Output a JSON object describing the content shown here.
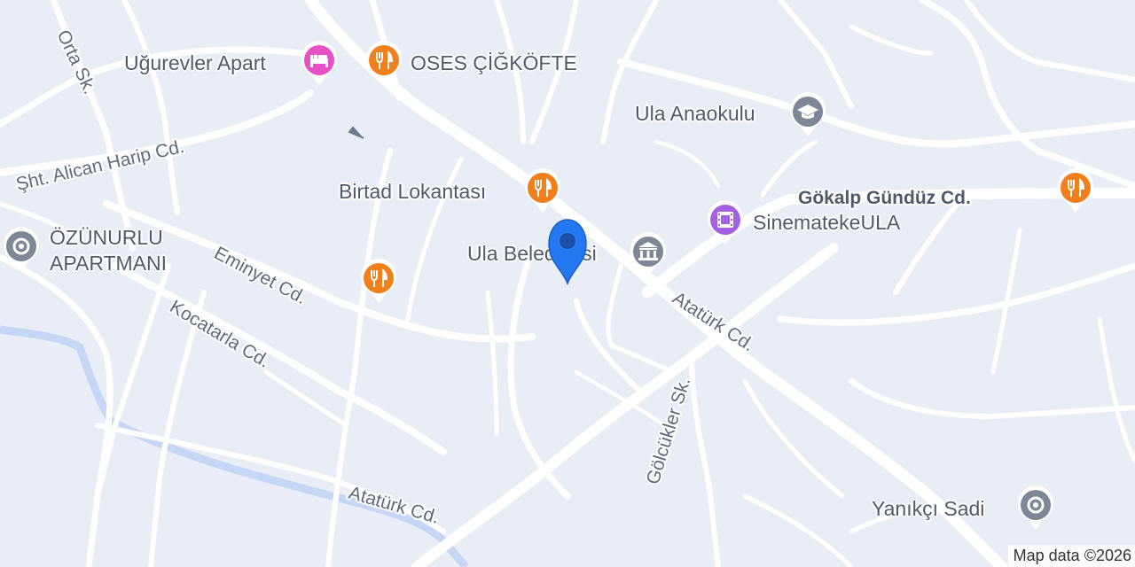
{
  "map": {
    "attribution": "Map data ©2026",
    "colors": {
      "background": "#e9edf6",
      "road": "#ffffff",
      "river": "#c5d7f5",
      "label": "#5f6b7d",
      "food_pin": "#f07f1c",
      "lodging_pin": "#e651c8",
      "education_pin": "#7d8896",
      "entertainment_pin": "#a45fe3",
      "civic_pin": "#7d8896",
      "place_pin": "#7d8896",
      "selected_marker": "#2479f2"
    }
  },
  "streets": {
    "orta": "Orta Sk.",
    "sht_alican": "Şht. Alican Harip Cd.",
    "eminyet": "Eminyet Cd.",
    "kocatarla": "Kocatarla Cd.",
    "ataturk_upper": "Atatürk Cd.",
    "ataturk_lower": "Atatürk Cd.",
    "golcukler": "Gölcükler Sk.",
    "gokalp": "Gökalp Gündüz Cd."
  },
  "places": {
    "ugurevler": {
      "name": "Uğurevler Apart",
      "icon": "bed-icon"
    },
    "oses": {
      "name": "OSES ÇİĞKÖFTE",
      "icon": "fork-knife-icon"
    },
    "ula_anaokulu": {
      "name": "Ula Anaokulu",
      "icon": "graduation-cap-icon"
    },
    "birtad": {
      "name": "Birtad Lokantası",
      "icon": "fork-knife-icon"
    },
    "sinemateke": {
      "name": "SinematekeULA",
      "icon": "film-icon"
    },
    "ula_belediyesi": {
      "name": "Ula Belediyesi",
      "icon": "town-hall-icon"
    },
    "ozunurlu_line1": "ÖZÜNURLU",
    "ozunurlu_line2": "APARTMANI",
    "ozunurlu_icon": "place-dot-icon",
    "yanikci": {
      "name": "Yanıkçı Sadi",
      "icon": "place-dot-icon"
    },
    "restaurant_unlabeled_1": {
      "icon": "fork-knife-icon"
    },
    "restaurant_unlabeled_2": {
      "icon": "fork-knife-icon"
    }
  }
}
